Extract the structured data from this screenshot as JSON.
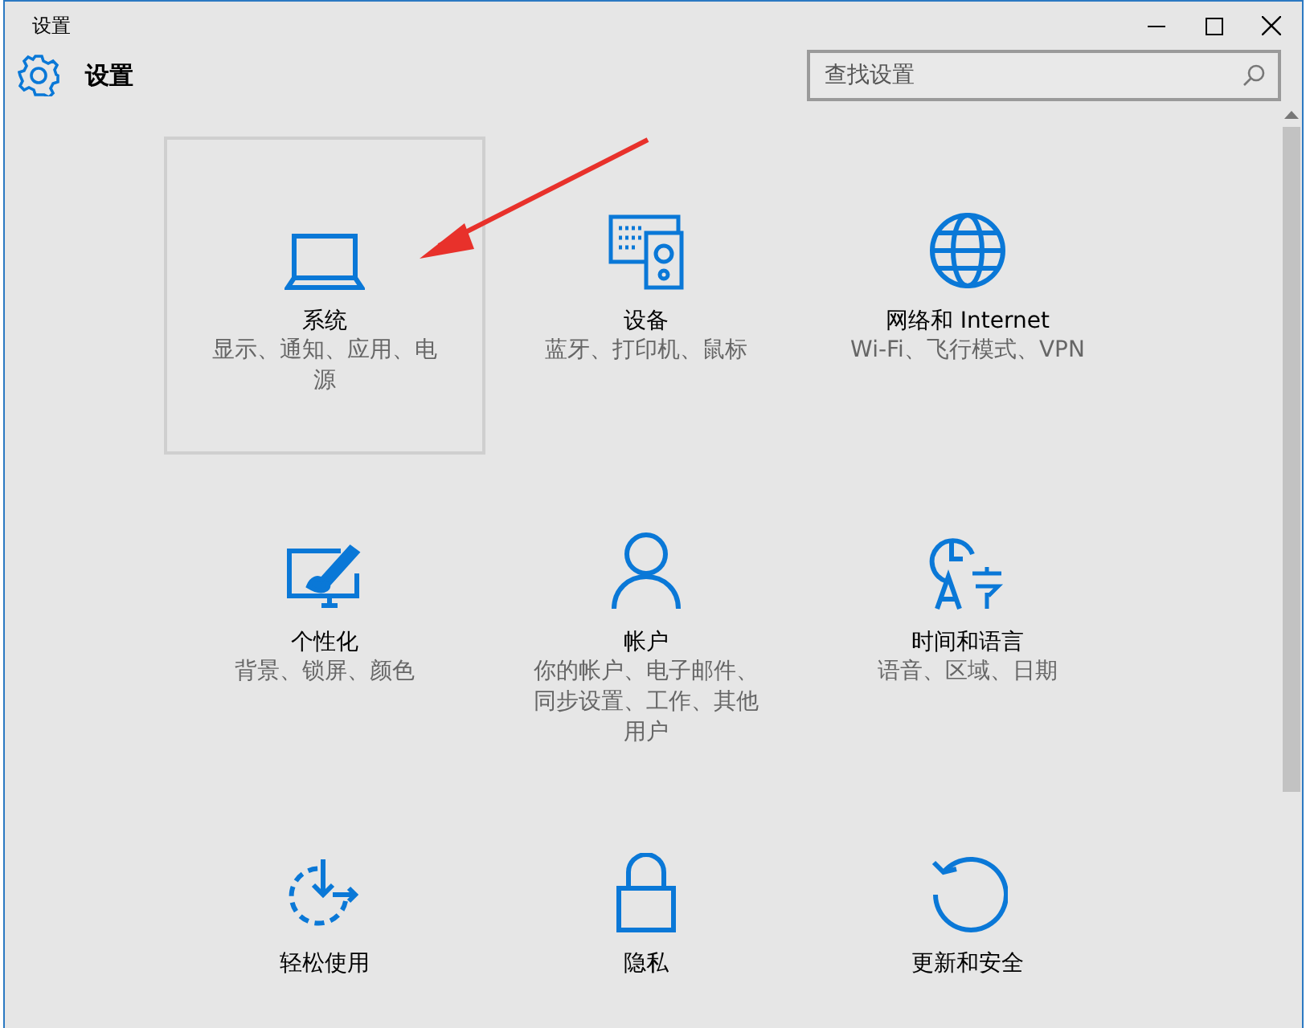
{
  "window": {
    "title": "设置"
  },
  "header": {
    "title": "设置"
  },
  "search": {
    "placeholder": "查找设置"
  },
  "tiles": [
    {
      "title": "系统",
      "description": "显示、通知、应用、电源",
      "selected": true
    },
    {
      "title": "设备",
      "description": "蓝牙、打印机、鼠标",
      "selected": false
    },
    {
      "title": "网络和 Internet",
      "description": "Wi-Fi、飞行模式、VPN",
      "selected": false
    },
    {
      "title": "个性化",
      "description": "背景、锁屏、颜色",
      "selected": false
    },
    {
      "title": "帐户",
      "description": "你的帐户、电子邮件、同步设置、工作、其他用户",
      "selected": false
    },
    {
      "title": "时间和语言",
      "description": "语音、区域、日期",
      "selected": false
    },
    {
      "title": "轻松使用",
      "selected": false
    },
    {
      "title": "隐私",
      "selected": false
    },
    {
      "title": "更新和安全",
      "selected": false
    }
  ]
}
